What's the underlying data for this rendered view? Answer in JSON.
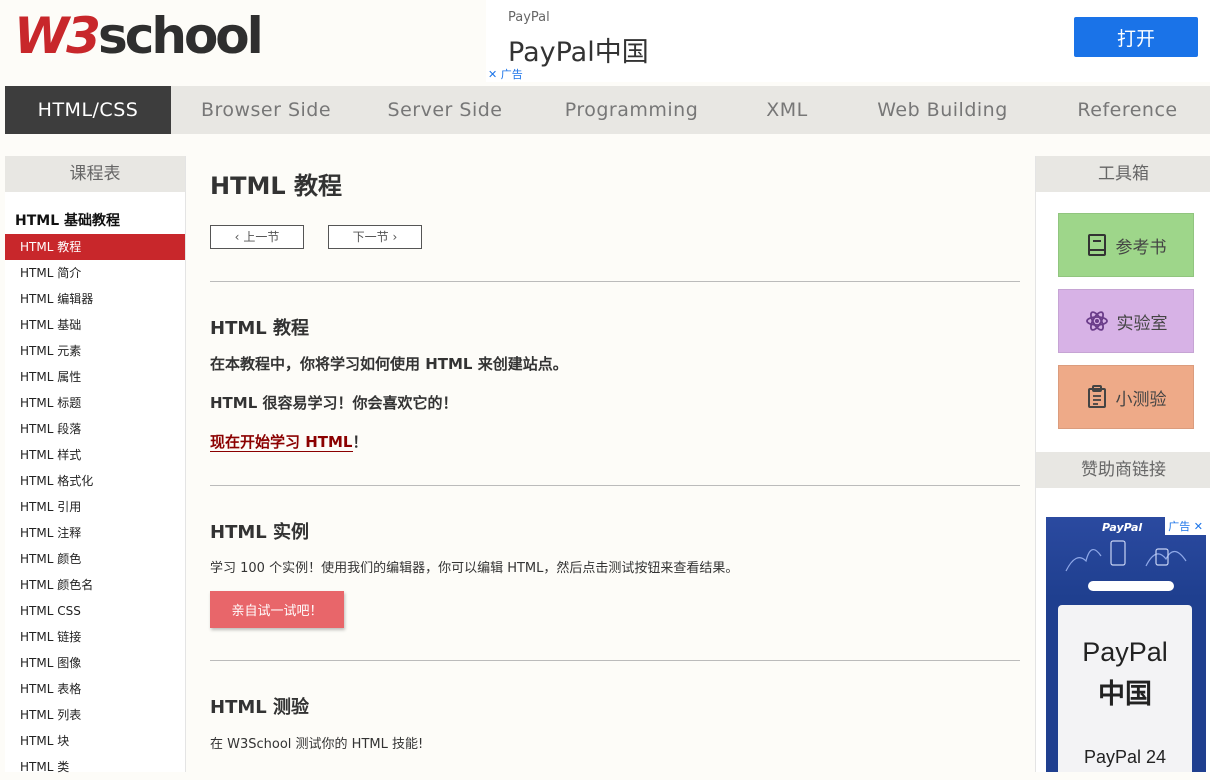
{
  "header": {
    "logo_w3": "W3",
    "logo_school": "school",
    "ad": {
      "brand": "PayPal",
      "title": "PayPal中国",
      "ad_mark": "广告",
      "open_button": "打开"
    }
  },
  "nav": {
    "items": [
      "HTML/CSS",
      "Browser Side",
      "Server Side",
      "Programming",
      "XML",
      "Web Building",
      "Reference"
    ],
    "active_index": 0
  },
  "sidebar": {
    "heading": "课程表",
    "category": "HTML 基础教程",
    "items": [
      "HTML 教程",
      "HTML 简介",
      "HTML 编辑器",
      "HTML 基础",
      "HTML 元素",
      "HTML 属性",
      "HTML 标题",
      "HTML 段落",
      "HTML 样式",
      "HTML 格式化",
      "HTML 引用",
      "HTML 注释",
      "HTML 颜色",
      "HTML 颜色名",
      "HTML CSS",
      "HTML 链接",
      "HTML 图像",
      "HTML 表格",
      "HTML 列表",
      "HTML 块",
      "HTML 类"
    ],
    "active_index": 0
  },
  "main": {
    "title": "HTML 教程",
    "prev_label": "上一节",
    "next_label": "下一节",
    "intro": {
      "heading": "HTML 教程",
      "p1": "在本教程中，你将学习如何使用 HTML 来创建站点。",
      "p2": "HTML 很容易学习！你会喜欢它的！",
      "start_link": "现在开始学习 HTML",
      "start_suffix": "！"
    },
    "examples": {
      "heading": "HTML 实例",
      "text": "学习 100 个实例！使用我们的编辑器，你可以编辑 HTML，然后点击测试按钮来查看结果。",
      "try_button": "亲自试一试吧！"
    },
    "quiz": {
      "heading": "HTML 测验",
      "text": "在 W3School 测试你的 HTML 技能!"
    }
  },
  "toolbox": {
    "heading": "工具箱",
    "reference": "参考书",
    "lab": "实验室",
    "quiz": "小测验",
    "sponsor_heading": "赞助商链接",
    "ad": {
      "brand": "PayPal",
      "ad_mark": "广告",
      "line1": "PayPal",
      "line2": "中国",
      "line3": "PayPal 24"
    }
  }
}
